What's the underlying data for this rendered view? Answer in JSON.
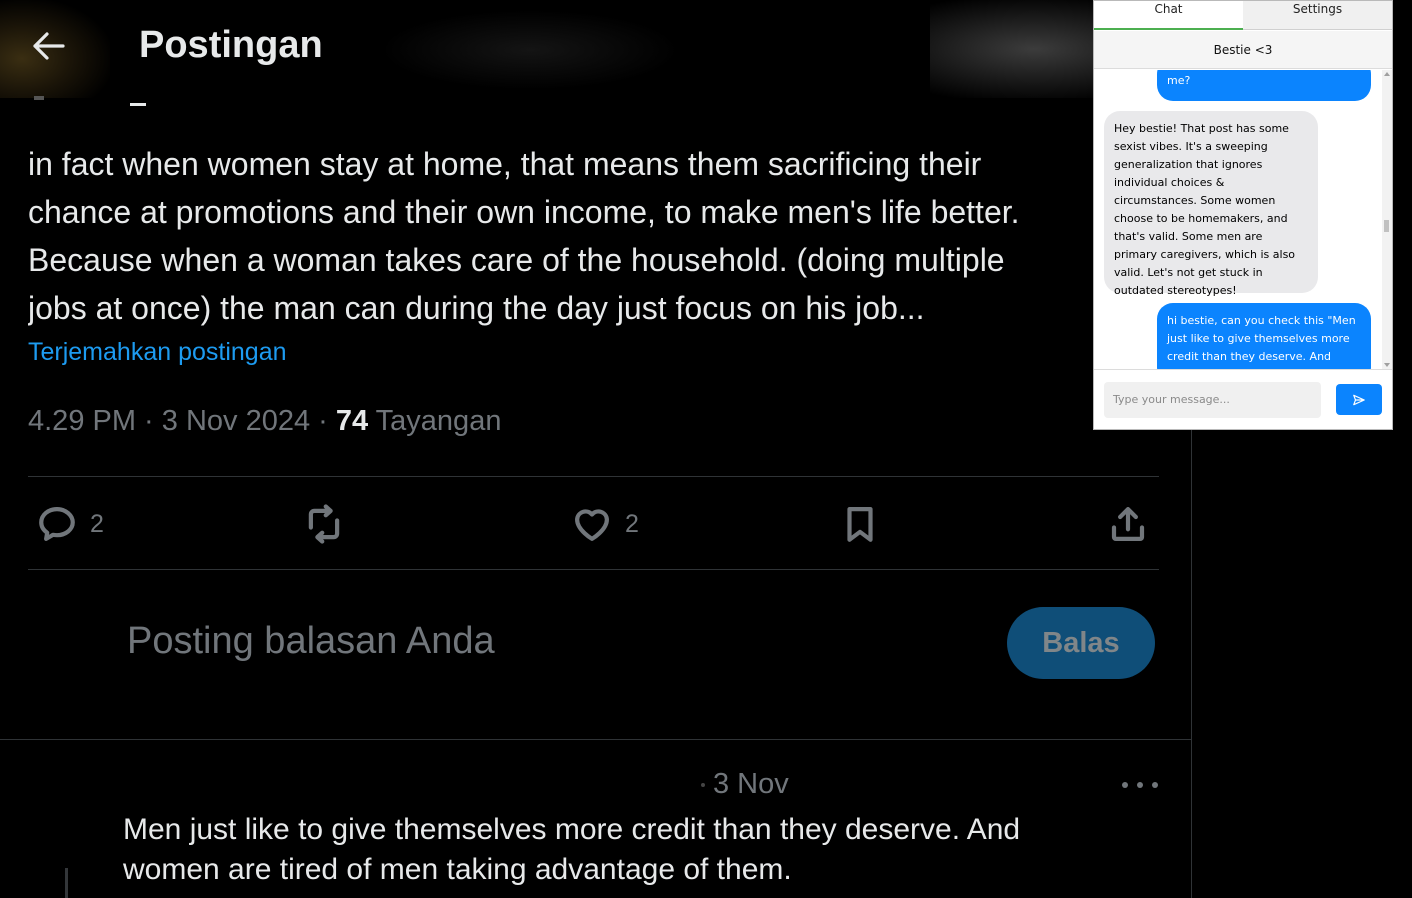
{
  "header": {
    "title": "Postingan"
  },
  "post": {
    "lines": [
      "in fact when women stay at home, that means them sacrificing their",
      "chance at promotions and their own income, to make men's life better.",
      "Because when a woman takes care of the household. (doing multiple",
      "jobs at once) the man can during the day just focus on his job..."
    ],
    "translate_link": "Terjemahkan postingan",
    "time": "4.29 PM · 3 Nov 2024 · ",
    "views_count": "74",
    "views_label": " Tayangan",
    "actions": {
      "reply_count": "2",
      "like_count": "2"
    }
  },
  "compose": {
    "placeholder": "Posting balasan Anda",
    "button_label": "Balas"
  },
  "reply": {
    "date": "3 Nov",
    "text": "Men just like to give themselves more credit than they deserve.  And women are tired of men taking advantage of them."
  },
  "chat": {
    "tabs": [
      "Chat",
      "Settings"
    ],
    "title": "Bestie <3",
    "messages": [
      {
        "role": "user",
        "text": "me?"
      },
      {
        "role": "bot",
        "text": "Hey bestie! That post has some sexist vibes. It's a sweeping generalization that ignores individual choices & circumstances. Some women choose to be homemakers, and that's valid. Some men are primary caregivers, which is also valid. Let's not get stuck in outdated stereotypes!"
      },
      {
        "role": "user",
        "text": "hi bestie, can you check this \"Men just like to give themselves more credit than they deserve. And"
      }
    ],
    "input_placeholder": "Type your message..."
  }
}
